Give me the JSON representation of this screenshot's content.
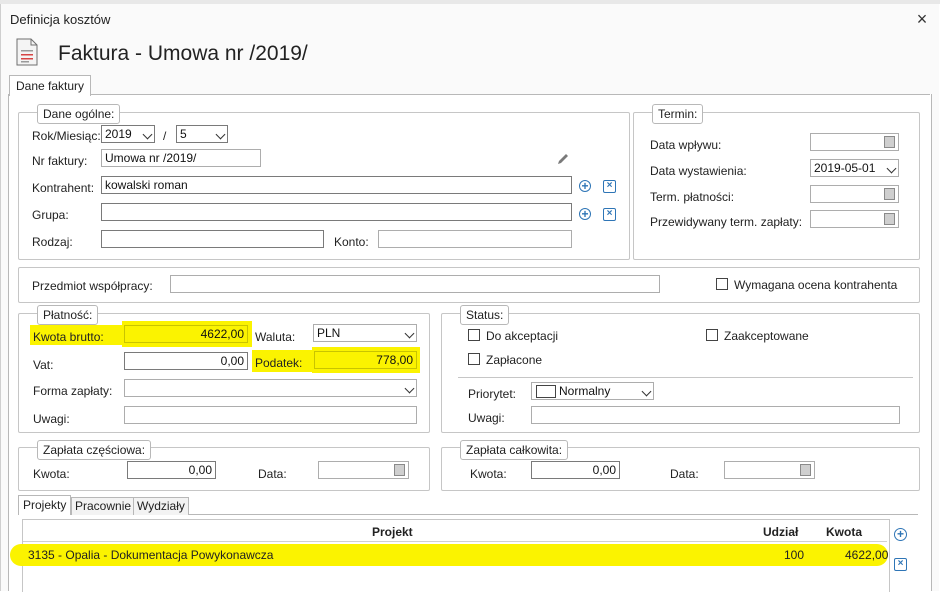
{
  "window": {
    "title": "Definicja kosztów",
    "close_glyph": "×",
    "close_icon": "close-icon"
  },
  "header": {
    "title": "Faktura - Umowa nr /2019/",
    "icon": "document-icon"
  },
  "tabs": [
    {
      "label": "Dane faktury"
    }
  ],
  "general": {
    "legend": "Dane ogólne:",
    "year_month_label": "Rok/Miesiąc:",
    "year": "2019",
    "separator": "/",
    "month": "5",
    "invoice_no_label": "Nr faktury:",
    "invoice_no": "Umowa nr /2019/",
    "contractor_label": "Kontrahent:",
    "contractor": "kowalski roman",
    "group_label": "Grupa:",
    "group": "",
    "kind_label": "Rodzaj:",
    "kind": "",
    "account_label": "Konto:",
    "account": ""
  },
  "term": {
    "legend": "Termin:",
    "inflow_label": "Data wpływu:",
    "inflow": "",
    "issue_label": "Data wystawienia:",
    "issue": "2019-05-01",
    "payment_label": "Term. płatności:",
    "payment": "",
    "expected_label": "Przewidywany term. zapłaty:",
    "expected": ""
  },
  "subject": {
    "label": "Przedmiot współpracy:",
    "value": "",
    "rating_label": "Wymagana ocena kontrahenta"
  },
  "payment": {
    "legend": "Płatność:",
    "gross_label": "Kwota brutto:",
    "gross": "4622,00",
    "currency_label": "Waluta:",
    "currency": "PLN",
    "vat_label": "Vat:",
    "vat": "0,00",
    "tax_label": "Podatek:",
    "tax": "778,00",
    "form_label": "Forma zapłaty:",
    "form": "",
    "notes_label": "Uwagi:",
    "notes": ""
  },
  "status": {
    "legend": "Status:",
    "to_accept_label": "Do akceptacji",
    "accepted_label": "Zaakceptowane",
    "paid_label": "Zapłacone",
    "priority_label": "Priorytet:",
    "priority": "Normalny",
    "notes_label": "Uwagi:",
    "notes": ""
  },
  "partial": {
    "legend": "Zapłata częściowa:",
    "amount_label": "Kwota:",
    "amount": "0,00",
    "date_label": "Data:",
    "date": ""
  },
  "full": {
    "legend": "Zapłata całkowita:",
    "amount_label": "Kwota:",
    "amount": "0,00",
    "date_label": "Data:",
    "date": ""
  },
  "bottom_tabs": [
    {
      "label": "Projekty"
    },
    {
      "label": "Pracownie"
    },
    {
      "label": "Wydziały"
    }
  ],
  "projects_table": {
    "columns": [
      "Projekt",
      "Udział",
      "Kwota"
    ],
    "rows": [
      {
        "project": "3135 - Opalia - Dokumentacja Powykonawcza",
        "share": "100",
        "amount": "4622,00"
      }
    ]
  },
  "glyphs": {
    "add": "+",
    "remove": "×"
  },
  "colors": {
    "highlight": "#fbf300",
    "accent": "#2e75b6",
    "border": "#c6c6c6"
  }
}
